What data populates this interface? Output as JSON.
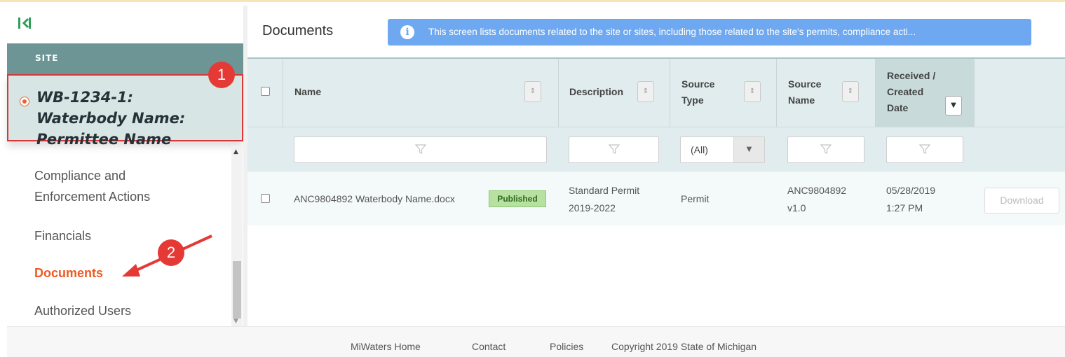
{
  "sidebar": {
    "section_label": "SITE",
    "site_name": "WB-1234-1: Waterbody Name: Permittee Name",
    "nav_items": [
      "Compliance and Enforcement Actions",
      "Financials",
      "Documents",
      "Authorized Users"
    ],
    "selected_item": "Documents"
  },
  "annotations": {
    "badge_1": "1",
    "badge_2": "2"
  },
  "main": {
    "title": "Documents",
    "info_banner": "This screen lists documents related to the site or sites, including those related to the site's permits, compliance acti..."
  },
  "table": {
    "headers": {
      "name": "Name",
      "description": "Description",
      "source_type": "Source Type",
      "source_name": "Source Name",
      "received_date": "Received / Created Date"
    },
    "source_type_filter": "(All)",
    "rows": [
      {
        "name": "ANC9804892 Waterbody Name.docx",
        "status": "Published",
        "description": "Standard Permit 2019-2022",
        "source_type": "Permit",
        "source_name": "ANC9804892 v1.0",
        "received_date": "05/28/2019 1:27 PM",
        "action": "Download"
      }
    ]
  },
  "footer": {
    "home": "MiWaters Home",
    "contact": "Contact",
    "policies": "Policies",
    "copyright": "Copyright 2019 State of Michigan"
  },
  "colors": {
    "site_band": "#6e9595",
    "site_card": "#d8e5e5",
    "highlight_border": "#d93636",
    "active_nav": "#ee5a24",
    "banner": "#6ea8f0",
    "grid_header": "#e0eced",
    "published": "#b8e0a3"
  },
  "icons": [
    "collapse-sidebar-icon",
    "radio-selected-icon",
    "info-icon",
    "sort-icon",
    "sort-desc-icon",
    "filter-icon",
    "dropdown-arrow-icon",
    "arrow-annotation-icon"
  ]
}
